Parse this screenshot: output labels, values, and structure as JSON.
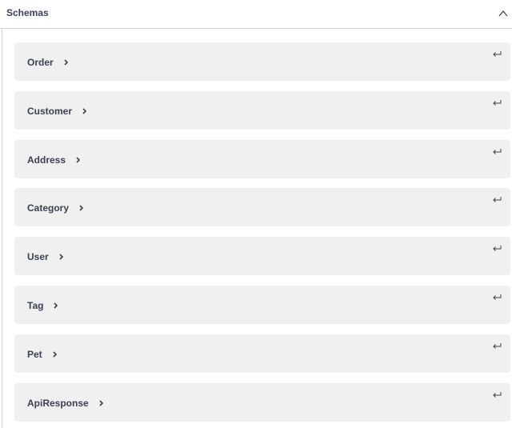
{
  "schemas": {
    "title": "Schemas",
    "models": [
      {
        "name": "Order"
      },
      {
        "name": "Customer"
      },
      {
        "name": "Address"
      },
      {
        "name": "Category"
      },
      {
        "name": "User"
      },
      {
        "name": "Tag"
      },
      {
        "name": "Pet"
      },
      {
        "name": "ApiResponse"
      }
    ]
  },
  "icons": {
    "collapse": "chevron-up-icon",
    "expand": "chevron-right-icon",
    "jump": "return-arrow-icon"
  },
  "colors": {
    "text": "#3b4151",
    "model_background": "#f0f0f0",
    "border": "#d3d3d3"
  }
}
